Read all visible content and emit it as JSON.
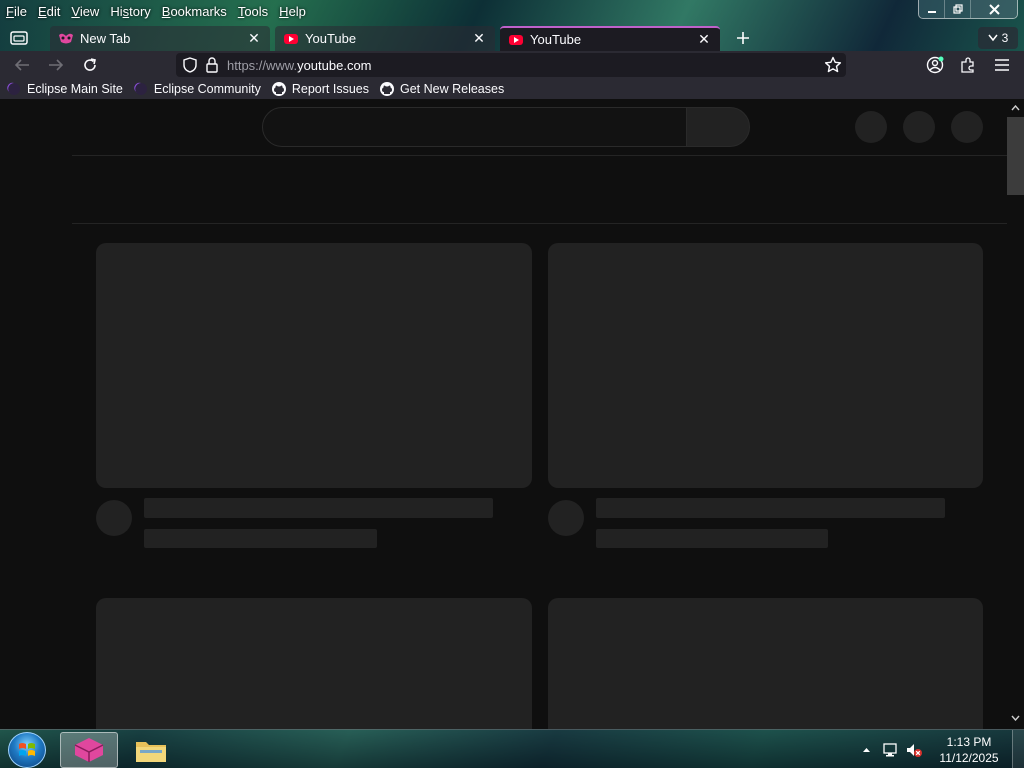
{
  "menu": [
    "File",
    "Edit",
    "View",
    "History",
    "Bookmarks",
    "Tools",
    "Help"
  ],
  "menu_underline": [
    "F",
    "E",
    "V",
    "s",
    "B",
    "T",
    "H"
  ],
  "tabs": [
    {
      "label": "New Tab",
      "favicon": "firefox-private-icon",
      "state": "inactive"
    },
    {
      "label": "YouTube",
      "favicon": "youtube-icon",
      "state": "inactive"
    },
    {
      "label": "YouTube",
      "favicon": "youtube-icon",
      "state": "active"
    }
  ],
  "tab_count": "3",
  "url": {
    "scheme": "https://www.",
    "host": "youtube.com"
  },
  "bookmarks": [
    {
      "label": "Eclipse Main Site",
      "icon": "eclipse-icon"
    },
    {
      "label": "Eclipse Community",
      "icon": "eclipse-icon"
    },
    {
      "label": "Report Issues",
      "icon": "github-icon"
    },
    {
      "label": "Get New Releases",
      "icon": "github-icon"
    }
  ],
  "taskbar": {
    "time": "1:13 PM",
    "date": "11/12/2025"
  },
  "colors": {
    "accent": "#c061cb",
    "youtube": "#ff0033",
    "content_bg": "#0f0f0f",
    "skeleton": "#222222"
  }
}
